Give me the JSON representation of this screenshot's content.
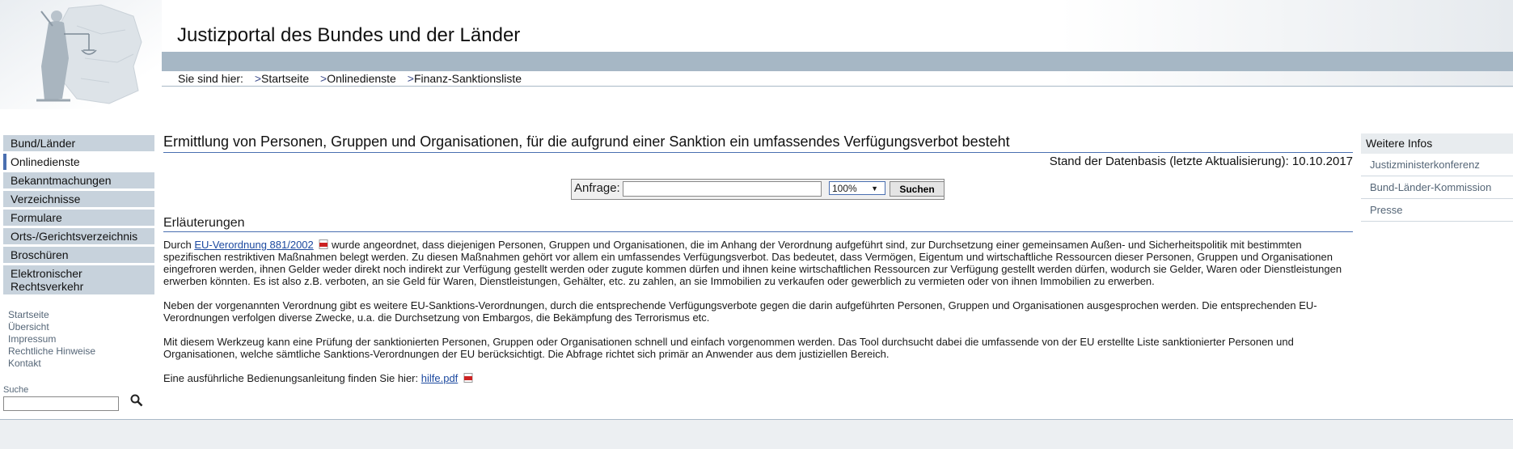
{
  "header": {
    "site_title": "Justizportal des Bundes und der Länder",
    "breadcrumb_prefix": "Sie sind hier:",
    "breadcrumb": [
      {
        "label": "Startseite"
      },
      {
        "label": "Onlinedienste"
      },
      {
        "label": "Finanz-Sanktionsliste"
      }
    ]
  },
  "leftnav": {
    "items": [
      {
        "label": "Bund/Länder"
      },
      {
        "label": "Onlinedienste"
      },
      {
        "label": "Bekanntmachungen"
      },
      {
        "label": "Verzeichnisse"
      },
      {
        "label": "Formulare"
      },
      {
        "label": "Orts-/Gerichtsverzeichnis"
      },
      {
        "label": "Broschüren"
      },
      {
        "label": "Elektronischer Rechtsverkehr"
      }
    ],
    "meta_links": [
      "Startseite",
      "Übersicht",
      "Impressum",
      "Rechtliche Hinweise",
      "Kontakt"
    ],
    "search_label": "Suche"
  },
  "main": {
    "title": "Ermittlung von Personen, Gruppen und Organisationen, für die aufgrund einer Sanktion ein umfassendes Verfügungsverbot besteht",
    "stand": "Stand der Datenbasis (letzte Aktualisierung): 10.10.2017",
    "query": {
      "label": "Anfrage:",
      "value": "",
      "zoom": "100%",
      "button": "Suchen"
    },
    "section_title": "Erläuterungen",
    "p1_prefix": "Durch",
    "p1_link": "EU-Verordnung 881/2002",
    "p1_rest": "wurde angeordnet, dass diejenigen Personen, Gruppen und Organisationen, die im Anhang der Verordnung aufgeführt sind, zur Durchsetzung einer gemeinsamen Außen- und Sicherheitspolitik mit bestimmten spezifischen restriktiven Maßnahmen belegt werden. Zu diesen Maßnahmen gehört vor allem ein umfassendes Verfügungsverbot. Das bedeutet, dass Vermögen, Eigentum und wirtschaftliche Ressourcen dieser Personen, Gruppen und Organisationen eingefroren werden, ihnen Gelder weder direkt noch indirekt zur Verfügung gestellt werden oder zugute kommen dürfen und ihnen keine wirtschaftlichen Ressourcen zur Verfügung gestellt werden dürfen, wodurch sie Gelder, Waren oder Dienstleistungen erwerben könnten. Es ist also z.B. verboten, an sie Geld für Waren, Dienstleistungen, Gehälter, etc. zu zahlen, an sie Immobilien zu verkaufen oder gewerblich zu vermieten oder von ihnen Immobilien zu erwerben.",
    "p2": "Neben der vorgenannten Verordnung gibt es weitere EU-Sanktions-Verordnungen, durch die entsprechende Verfügungsverbote gegen die darin aufgeführten Personen, Gruppen und Organisationen ausgesprochen werden. Die entsprechenden EU-Verordnungen verfolgen diverse Zwecke, u.a. die Durchsetzung von Embargos, die Bekämpfung des Terrorismus etc.",
    "p3": "Mit diesem Werkzeug kann eine Prüfung der sanktionierten Personen, Gruppen oder Organisationen schnell und einfach vorgenommen werden. Das Tool durchsucht dabei die umfassende von der EU erstellte Liste sanktionierter Personen und Organisationen, welche sämtliche Sanktions-Verordnungen der EU berücksichtigt. Die Abfrage richtet sich primär an Anwender aus dem justiziellen Bereich.",
    "p4_prefix": "Eine ausführliche Bedienungsanleitung finden Sie hier:",
    "p4_link": "hilfe.pdf"
  },
  "rightbox": {
    "title": "Weitere Infos",
    "items": [
      "Justizministerkonferenz",
      "Bund-Länder-Kommission",
      "Presse"
    ]
  },
  "icons": {
    "logo": "justitia-logo",
    "pdf": "pdf-icon",
    "search": "magnifier-icon"
  },
  "colors": {
    "band": "#a6b7c5",
    "nav_bg": "#c7d2dc",
    "accent": "#4a6fb0",
    "link": "#1d4aa0"
  }
}
